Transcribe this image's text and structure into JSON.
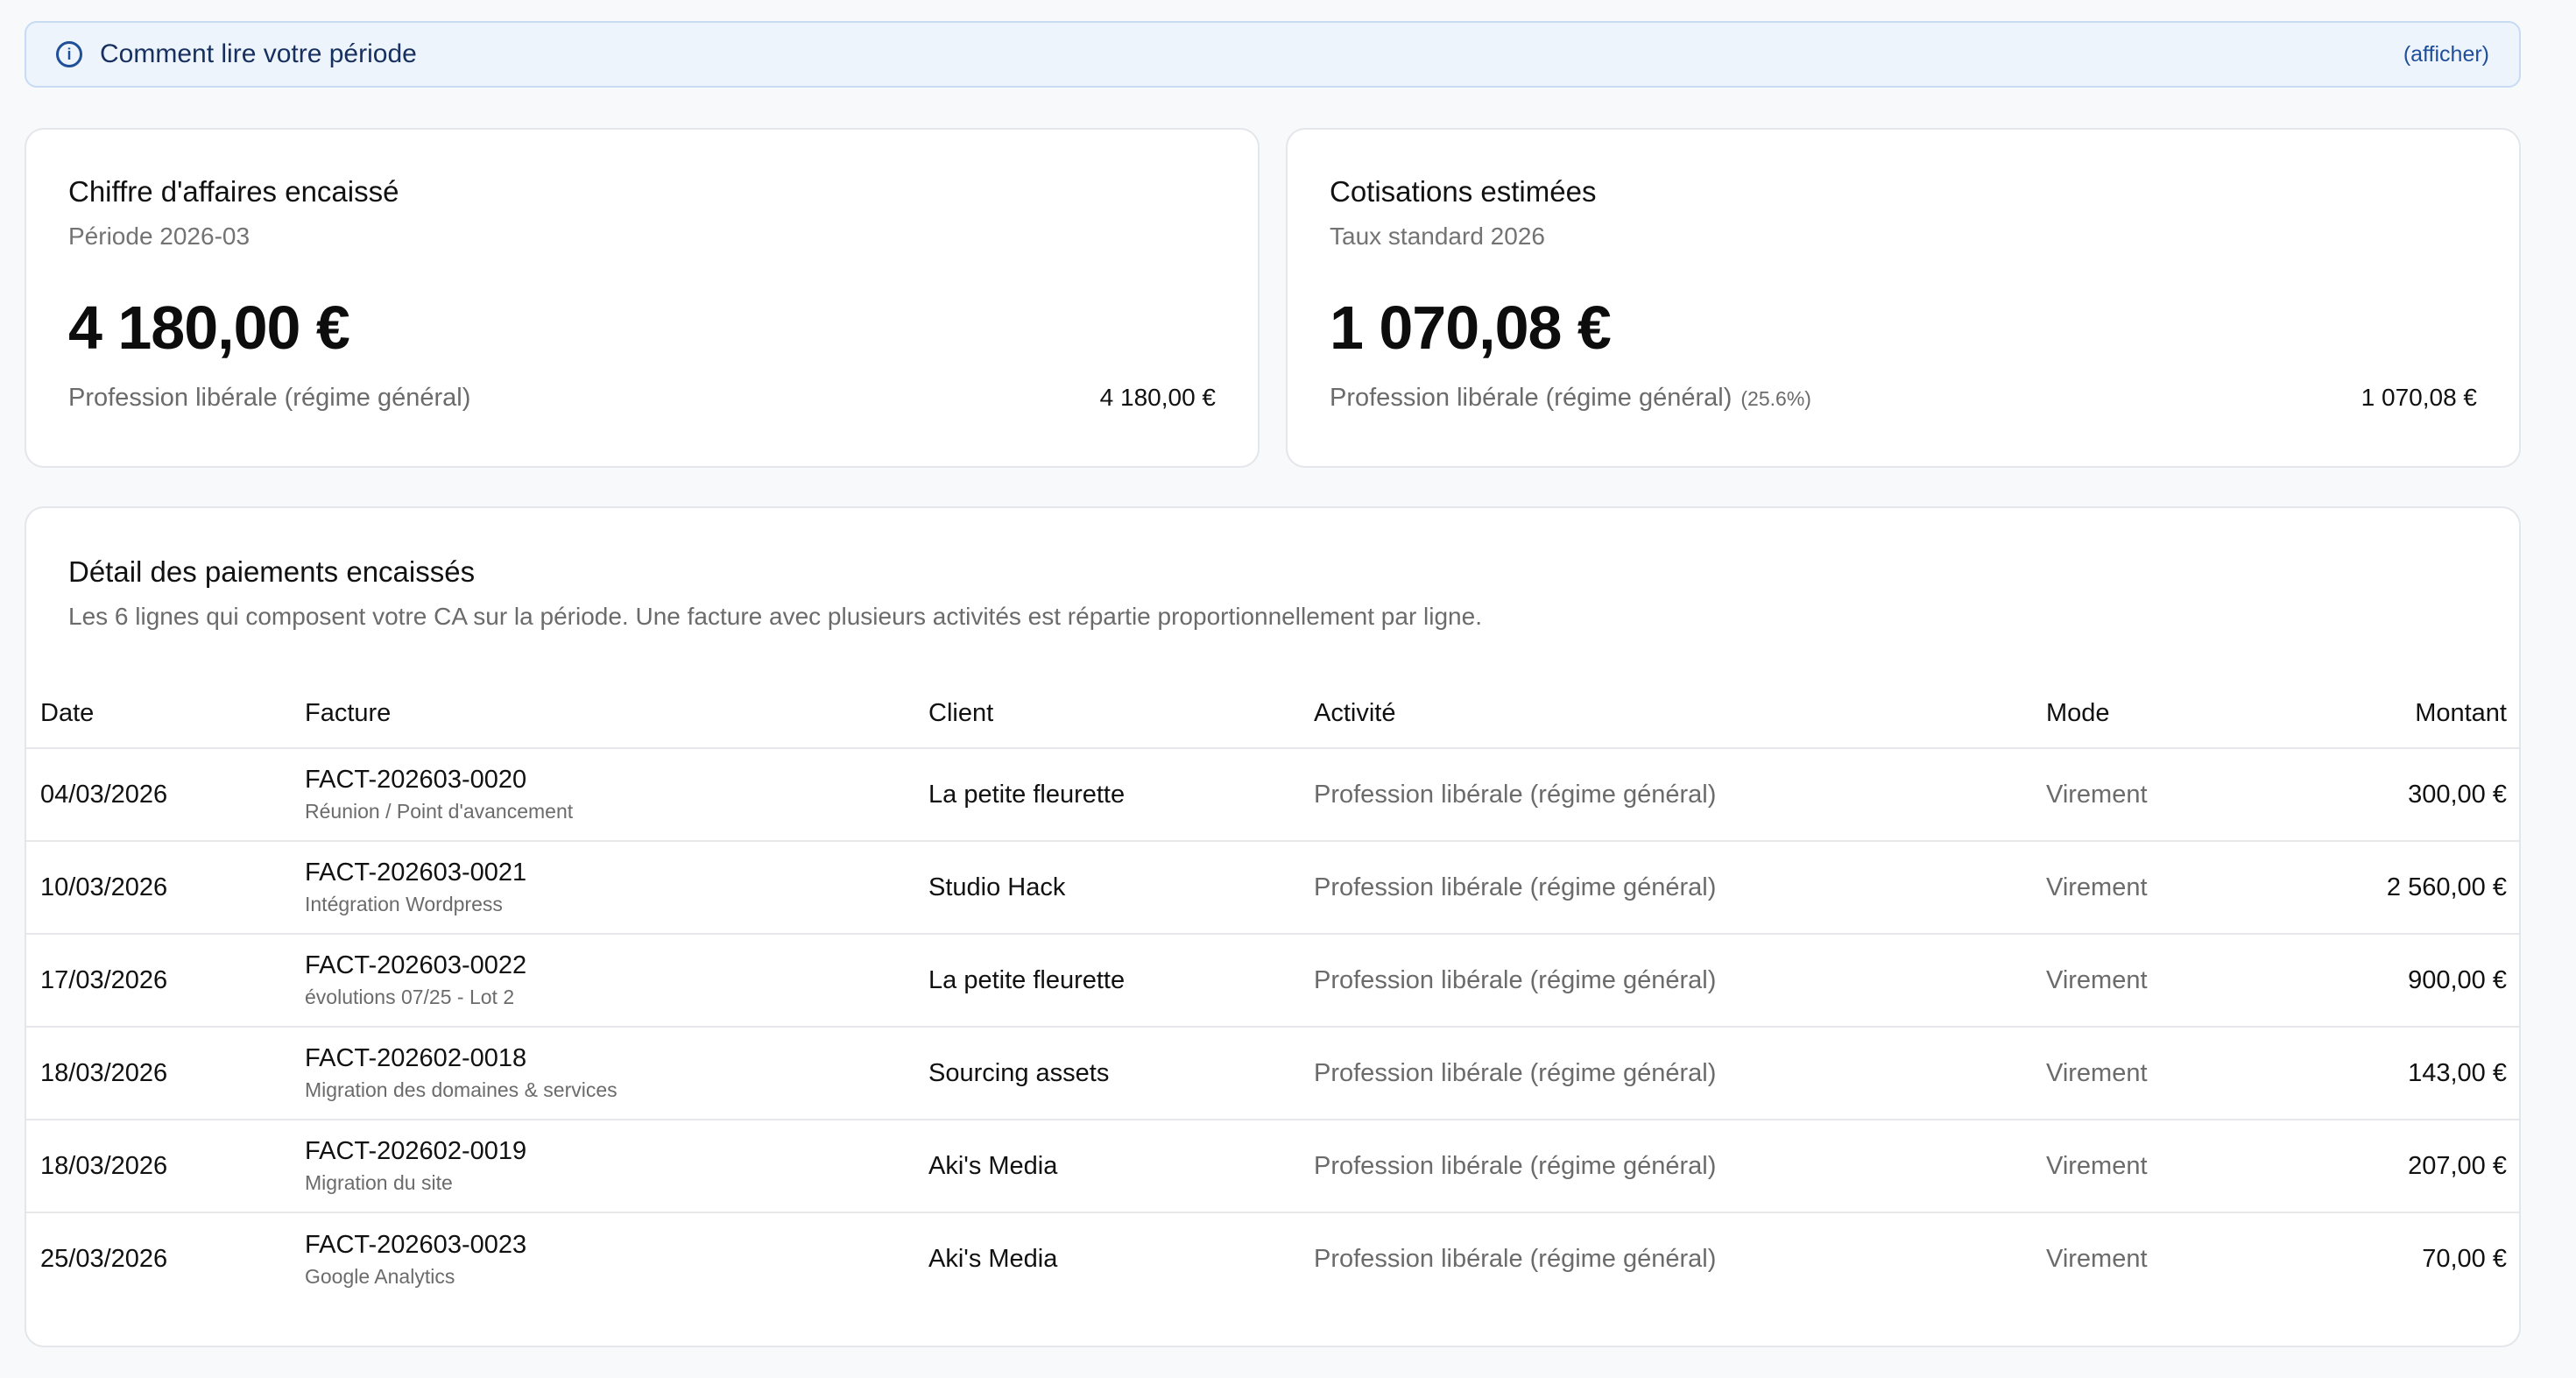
{
  "banner": {
    "title": "Comment lire votre période",
    "toggle_label": "(afficher)"
  },
  "revenue_card": {
    "title": "Chiffre d'affaires encaissé",
    "subtitle": "Période 2026-03",
    "total": "4 180,00 €",
    "line_label": "Profession libérale (régime général)",
    "line_amount": "4 180,00 €"
  },
  "contrib_card": {
    "title": "Cotisations estimées",
    "subtitle": "Taux standard 2026",
    "total": "1 070,08 €",
    "line_label": "Profession libérale (régime général)",
    "line_rate": "(25.6%)",
    "line_amount": "1 070,08 €"
  },
  "detail": {
    "title": "Détail des paiements encaissés",
    "description": "Les 6 lignes qui composent votre CA sur la période. Une facture avec plusieurs activités est répartie proportionnellement par ligne.",
    "columns": {
      "date": "Date",
      "invoice": "Facture",
      "client": "Client",
      "activity": "Activité",
      "mode": "Mode",
      "amount": "Montant"
    },
    "rows": [
      {
        "date": "04/03/2026",
        "invoice": "FACT-202603-0020",
        "invoice_desc": "Réunion / Point d'avancement",
        "client": "La petite fleurette",
        "activity": "Profession libérale (régime général)",
        "mode": "Virement",
        "amount": "300,00 €"
      },
      {
        "date": "10/03/2026",
        "invoice": "FACT-202603-0021",
        "invoice_desc": "Intégration Wordpress",
        "client": "Studio Hack",
        "activity": "Profession libérale (régime général)",
        "mode": "Virement",
        "amount": "2 560,00 €"
      },
      {
        "date": "17/03/2026",
        "invoice": "FACT-202603-0022",
        "invoice_desc": "évolutions 07/25 - Lot 2",
        "client": "La petite fleurette",
        "activity": "Profession libérale (régime général)",
        "mode": "Virement",
        "amount": "900,00 €"
      },
      {
        "date": "18/03/2026",
        "invoice": "FACT-202602-0018",
        "invoice_desc": "Migration des domaines & services",
        "client": "Sourcing assets",
        "activity": "Profession libérale (régime général)",
        "mode": "Virement",
        "amount": "143,00 €"
      },
      {
        "date": "18/03/2026",
        "invoice": "FACT-202602-0019",
        "invoice_desc": "Migration du site",
        "client": "Aki's Media",
        "activity": "Profession libérale (régime général)",
        "mode": "Virement",
        "amount": "207,00 €"
      },
      {
        "date": "25/03/2026",
        "invoice": "FACT-202603-0023",
        "invoice_desc": "Google Analytics",
        "client": "Aki's Media",
        "activity": "Profession libérale (régime général)",
        "mode": "Virement",
        "amount": "70,00 €"
      }
    ]
  },
  "colors": {
    "banner_bg": "#eef4fc",
    "banner_border": "#c7dbf3",
    "accent": "#1f4f99",
    "muted_text": "#6b6b6b"
  },
  "icons": {
    "banner": "info-icon"
  }
}
